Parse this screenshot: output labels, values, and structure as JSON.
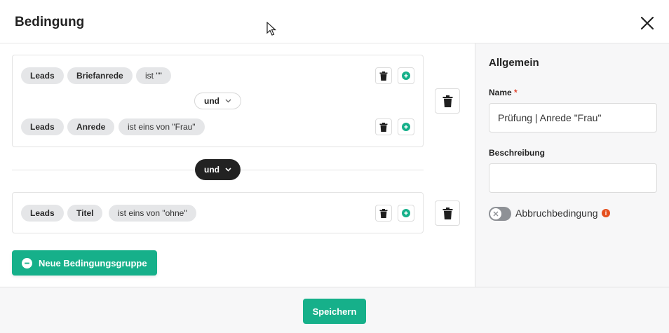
{
  "dialog": {
    "title": "Bedingung"
  },
  "groups": [
    {
      "conditions": [
        {
          "object": "Leads",
          "field": "Briefanrede",
          "operator": "ist \"\""
        },
        {
          "object": "Leads",
          "field": "Anrede",
          "operator": "ist eins von \"Frau\""
        }
      ],
      "connector": "und"
    },
    {
      "conditions": [
        {
          "object": "Leads",
          "field": "Titel",
          "operator": "ist eins von \"ohne\""
        }
      ]
    }
  ],
  "group_connector": "und",
  "new_group_label": "Neue Bedingungsgruppe",
  "sidebar": {
    "title": "Allgemein",
    "name_label": "Name",
    "required_mark": "*",
    "name_value": "Prüfung | Anrede \"Frau\"",
    "description_label": "Beschreibung",
    "description_value": "",
    "abort_label": "Abbruchbedingung",
    "abort_enabled": false,
    "info_icon": "i"
  },
  "footer": {
    "save_label": "Speichern"
  },
  "colors": {
    "accent": "#16b08a",
    "info": "#e5501e",
    "dark": "#222222"
  }
}
